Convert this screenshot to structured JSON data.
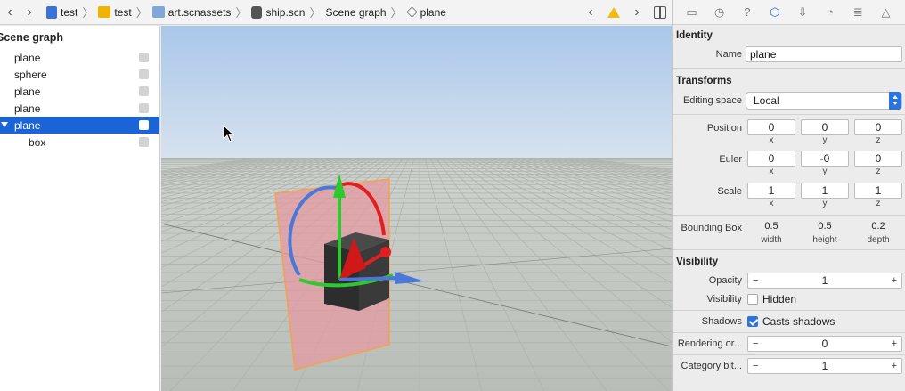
{
  "breadcrumbs": [
    {
      "label": "test",
      "icon": "project-file-icon"
    },
    {
      "label": "test",
      "icon": "folder-icon"
    },
    {
      "label": "art.scnassets",
      "icon": "asset-folder-icon"
    },
    {
      "label": "ship.scn",
      "icon": "scene-file-icon"
    },
    {
      "label": "Scene graph",
      "icon": ""
    },
    {
      "label": "plane",
      "icon": "cube-icon"
    }
  ],
  "scene_graph": {
    "title": "Scene graph",
    "items": [
      {
        "label": "plane",
        "selected": false,
        "child": false
      },
      {
        "label": "sphere",
        "selected": false,
        "child": false
      },
      {
        "label": "plane",
        "selected": false,
        "child": false
      },
      {
        "label": "plane",
        "selected": false,
        "child": false
      },
      {
        "label": "plane",
        "selected": true,
        "child": false
      },
      {
        "label": "box",
        "selected": false,
        "child": true
      }
    ]
  },
  "inspector": {
    "identity": {
      "title": "Identity",
      "name_label": "Name",
      "name_value": "plane"
    },
    "transforms": {
      "title": "Transforms",
      "editing_space_label": "Editing space",
      "editing_space_value": "Local",
      "position": {
        "label": "Position",
        "x": "0",
        "y": "0",
        "z": "0"
      },
      "euler": {
        "label": "Euler",
        "x": "0",
        "y": "-0",
        "z": "0"
      },
      "scale": {
        "label": "Scale",
        "x": "1",
        "y": "1",
        "z": "1"
      },
      "axis_x": "x",
      "axis_y": "y",
      "axis_z": "z",
      "bounding_box": {
        "label": "Bounding Box",
        "width": "0.5",
        "height": "0.5",
        "depth": "0.2",
        "width_label": "width",
        "height_label": "height",
        "depth_label": "depth"
      }
    },
    "visibility": {
      "title": "Visibility",
      "opacity_label": "Opacity",
      "opacity_value": "1",
      "visibility_label": "Visibility",
      "hidden_label": "Hidden",
      "shadows_label": "Shadows",
      "casts_shadows_label": "Casts shadows",
      "rendering_label": "Rendering or...",
      "rendering_value": "0",
      "category_label": "Category bit...",
      "category_value": "1"
    },
    "stepper_minus": "−",
    "stepper_plus": "+"
  },
  "colors": {
    "selection": "#1a64d8",
    "accent": "#2a73e0",
    "warning": "#f2bb13"
  }
}
